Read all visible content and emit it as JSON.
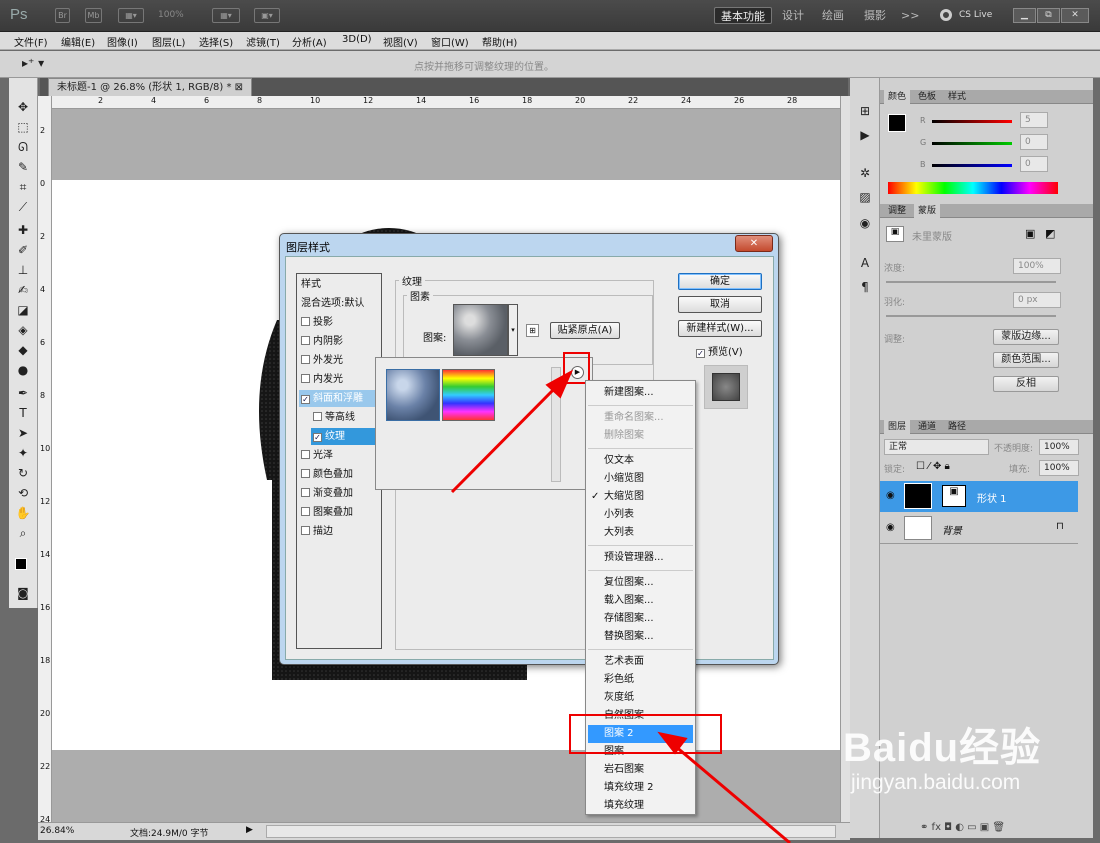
{
  "app": {
    "logo": "Ps",
    "zoom": "100%",
    "workspaces": [
      "基本功能",
      "设计",
      "绘画",
      "摄影"
    ],
    "more": ">>",
    "cslive": "CS Live"
  },
  "menu": [
    "文件(F)",
    "编辑(E)",
    "图像(I)",
    "图层(L)",
    "选择(S)",
    "滤镜(T)",
    "分析(A)",
    "3D(D)",
    "视图(V)",
    "窗口(W)",
    "帮助(H)"
  ],
  "options": {
    "hint": "点按并拖移可调整纹理的位置。"
  },
  "document": {
    "tab": "未标题-1 @ 26.8% (形状 1, RGB/8) *",
    "ruler_top": [
      "2",
      "4",
      "6",
      "8",
      "10",
      "12",
      "14",
      "16",
      "18",
      "20",
      "22",
      "24",
      "26",
      "28"
    ],
    "ruler_left": [
      "2",
      "0",
      "2",
      "4",
      "6",
      "8",
      "10",
      "12",
      "14",
      "16",
      "18",
      "20",
      "22",
      "24"
    ]
  },
  "status": {
    "zoom": "26.84%",
    "doc": "文档:24.9M/0 字节"
  },
  "color_panel": {
    "tabs": [
      "颜色",
      "色板",
      "样式"
    ],
    "r": "5",
    "g": "0",
    "b": "0",
    "labels": [
      "R",
      "G",
      "B"
    ]
  },
  "adjust_panel": {
    "tabs": [
      "调整",
      "蒙版"
    ],
    "title": "未里蒙版",
    "density_label": "浓度:",
    "density": "100%",
    "feather_label": "羽化:",
    "feather": "0 px",
    "refine_label": "调整:",
    "btn_edge": "蒙版边缘...",
    "btn_range": "颜色范围...",
    "btn_invert": "反相"
  },
  "layers_panel": {
    "tabs": [
      "图层",
      "通道",
      "路径"
    ],
    "blend": "正常",
    "opacity_label": "不透明度:",
    "opacity": "100%",
    "lock_label": "锁定:",
    "fill_label": "填充:",
    "fill": "100%",
    "layers": [
      "形状 1",
      "背景"
    ]
  },
  "dialog": {
    "title": "图层样式",
    "close": "✕",
    "styles": [
      {
        "label": "样式",
        "check": false
      },
      {
        "label": "混合选项:默认",
        "check": false
      },
      {
        "label": "投影",
        "check": true,
        "checked": false
      },
      {
        "label": "内阴影",
        "check": true,
        "checked": false
      },
      {
        "label": "外发光",
        "check": true,
        "checked": false
      },
      {
        "label": "内发光",
        "check": true,
        "checked": false
      },
      {
        "label": "斜面和浮雕",
        "check": true,
        "checked": true
      },
      {
        "label": "等高线",
        "check": true,
        "checked": false
      },
      {
        "label": "纹理",
        "check": true,
        "checked": true
      },
      {
        "label": "光泽",
        "check": true,
        "checked": false
      },
      {
        "label": "颜色叠加",
        "check": true,
        "checked": false
      },
      {
        "label": "渐变叠加",
        "check": true,
        "checked": false
      },
      {
        "label": "图案叠加",
        "check": true,
        "checked": false
      },
      {
        "label": "描边",
        "check": true,
        "checked": false
      }
    ],
    "group_texture": "纹理",
    "group_pattern": "图素",
    "pattern_label": "图案:",
    "snap_button": "贴紧原点(A)",
    "ok": "确定",
    "cancel": "取消",
    "new_style": "新建样式(W)...",
    "preview": "预览(V)"
  },
  "context_menu": [
    {
      "label": "新建图案...",
      "state": "normal"
    },
    {
      "sep": true
    },
    {
      "label": "重命名图案...",
      "state": "disabled"
    },
    {
      "label": "删除图案",
      "state": "disabled"
    },
    {
      "sep": true
    },
    {
      "label": "仅文本",
      "state": "normal"
    },
    {
      "label": "小缩览图",
      "state": "normal"
    },
    {
      "label": "大缩览图",
      "state": "checked"
    },
    {
      "label": "小列表",
      "state": "normal"
    },
    {
      "label": "大列表",
      "state": "normal"
    },
    {
      "sep": true
    },
    {
      "label": "预设管理器...",
      "state": "normal"
    },
    {
      "sep": true
    },
    {
      "label": "复位图案...",
      "state": "normal"
    },
    {
      "label": "载入图案...",
      "state": "normal"
    },
    {
      "label": "存储图案...",
      "state": "normal"
    },
    {
      "label": "替换图案...",
      "state": "normal"
    },
    {
      "sep": true
    },
    {
      "label": "艺术表面",
      "state": "normal"
    },
    {
      "label": "彩色纸",
      "state": "normal"
    },
    {
      "label": "灰度纸",
      "state": "normal"
    },
    {
      "label": "自然图案",
      "state": "normal"
    },
    {
      "label": "图案 2",
      "state": "highlight"
    },
    {
      "label": "图案",
      "state": "normal"
    },
    {
      "label": "岩石图案",
      "state": "normal"
    },
    {
      "label": "填充纹理 2",
      "state": "normal"
    },
    {
      "label": "填充纹理",
      "state": "normal"
    }
  ],
  "watermark": {
    "brand": "Baidu经验",
    "url": "jingyan.baidu.com"
  },
  "colors": {
    "accent": "#3399ff",
    "annotation": "#e00000"
  }
}
